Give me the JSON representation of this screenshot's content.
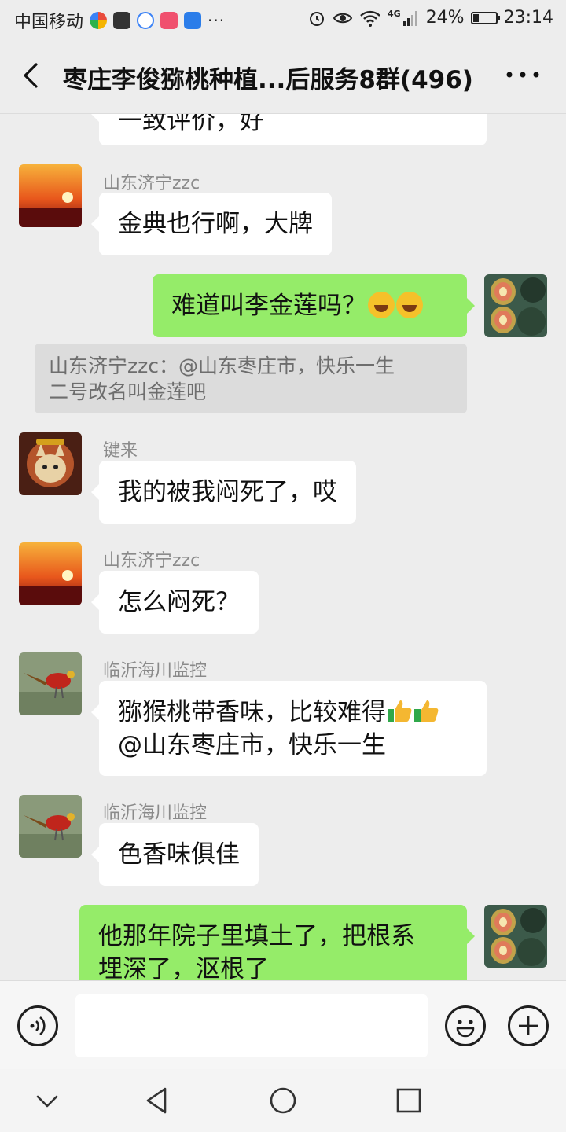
{
  "status_bar": {
    "carrier": "中国移动",
    "dots": "···",
    "network": "4G",
    "battery_percent": "24%",
    "battery_level": 0.24,
    "time": "23:14"
  },
  "header": {
    "title": "枣庄李俊猕桃种植...后服务8群(496)"
  },
  "messages": [
    {
      "direction": "in",
      "text": "一致评价，好"
    },
    {
      "direction": "in",
      "sender": "山东济宁zzc",
      "text": "金典也行啊，大牌"
    },
    {
      "direction": "out",
      "text": "难道叫李金莲吗？"
    },
    {
      "type": "quote",
      "text_line1": "山东济宁zzc：@山东枣庄市，快乐一生",
      "text_line2": "二号改名叫金莲吧"
    },
    {
      "direction": "in",
      "sender": "键来",
      "text": "我的被我闷死了，哎"
    },
    {
      "direction": "in",
      "sender": "山东济宁zzc",
      "text": "怎么闷死？"
    },
    {
      "direction": "in",
      "sender": "临沂海川监控",
      "text_line1": "猕猴桃带香味，比较难得",
      "text_line2": "@山东枣庄市，快乐一生"
    },
    {
      "direction": "in",
      "sender": "临沂海川监控",
      "text": "色香味俱佳"
    },
    {
      "direction": "out",
      "text_line1": "他那年院子里填土了，把根系",
      "text_line2": "埋深了，沤根了"
    }
  ],
  "input_bar": {
    "placeholder": ""
  },
  "colors": {
    "background": "#ededed",
    "outgoing_bubble": "#95ec69",
    "incoming_bubble": "#ffffff",
    "sender_name": "#8a8a8a"
  },
  "icons": [
    "back-arrow-icon",
    "more-icon",
    "voice-icon",
    "emoji-icon",
    "add-icon",
    "nav-collapse-icon",
    "nav-back-icon",
    "nav-home-icon",
    "nav-recents-icon"
  ]
}
